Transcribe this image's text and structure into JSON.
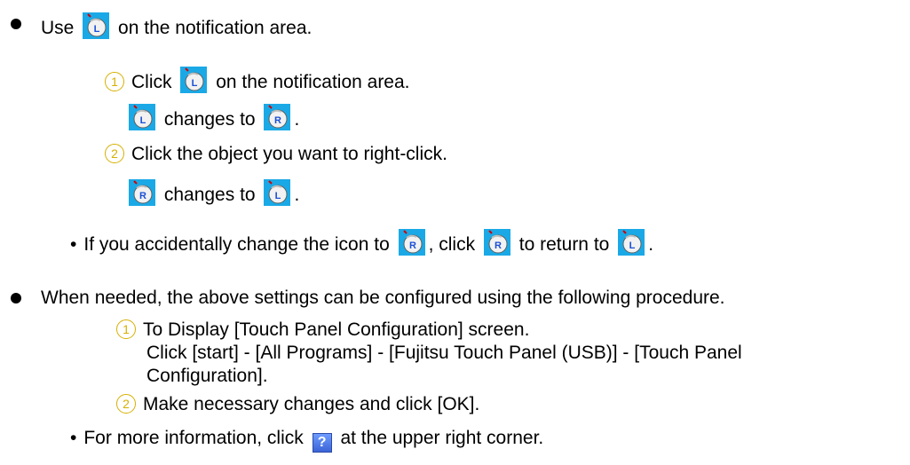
{
  "section1": {
    "intro_pre": "Use",
    "intro_post": "on the notification area.",
    "steps": [
      {
        "num": "1",
        "pre": "Click",
        "post": "on the notification area."
      },
      {
        "num": "2",
        "text": "Click the object you want to right-click."
      }
    ],
    "change1_text": "changes to",
    "change2_text": "changes to",
    "note_pre": "If you accidentally change the icon to",
    "note_mid": ", click",
    "note_mid2": "to return to",
    "note_end": "."
  },
  "section2": {
    "intro": "When needed, the above settings can be configured using the following procedure.",
    "step1_num": "1",
    "step1_title": "To Display [Touch Panel Configuration] screen.",
    "step1_detail_line1": "Click [start] - [All Programs] - [Fujitsu Touch Panel (USB)] - [Touch Panel",
    "step1_detail_line2": "Configuration].",
    "step2_num": "2",
    "step2_text": "Make necessary changes and click [OK].",
    "note_pre": "For more information, click",
    "note_post": "at the upper right corner."
  },
  "icons": {
    "left_click": "left-click-mode-icon",
    "right_click": "right-click-mode-icon",
    "help": "help-icon",
    "help_glyph": "?"
  },
  "colors": {
    "number_circle": "#d6b000",
    "icon_background": "#1aa9e6"
  }
}
